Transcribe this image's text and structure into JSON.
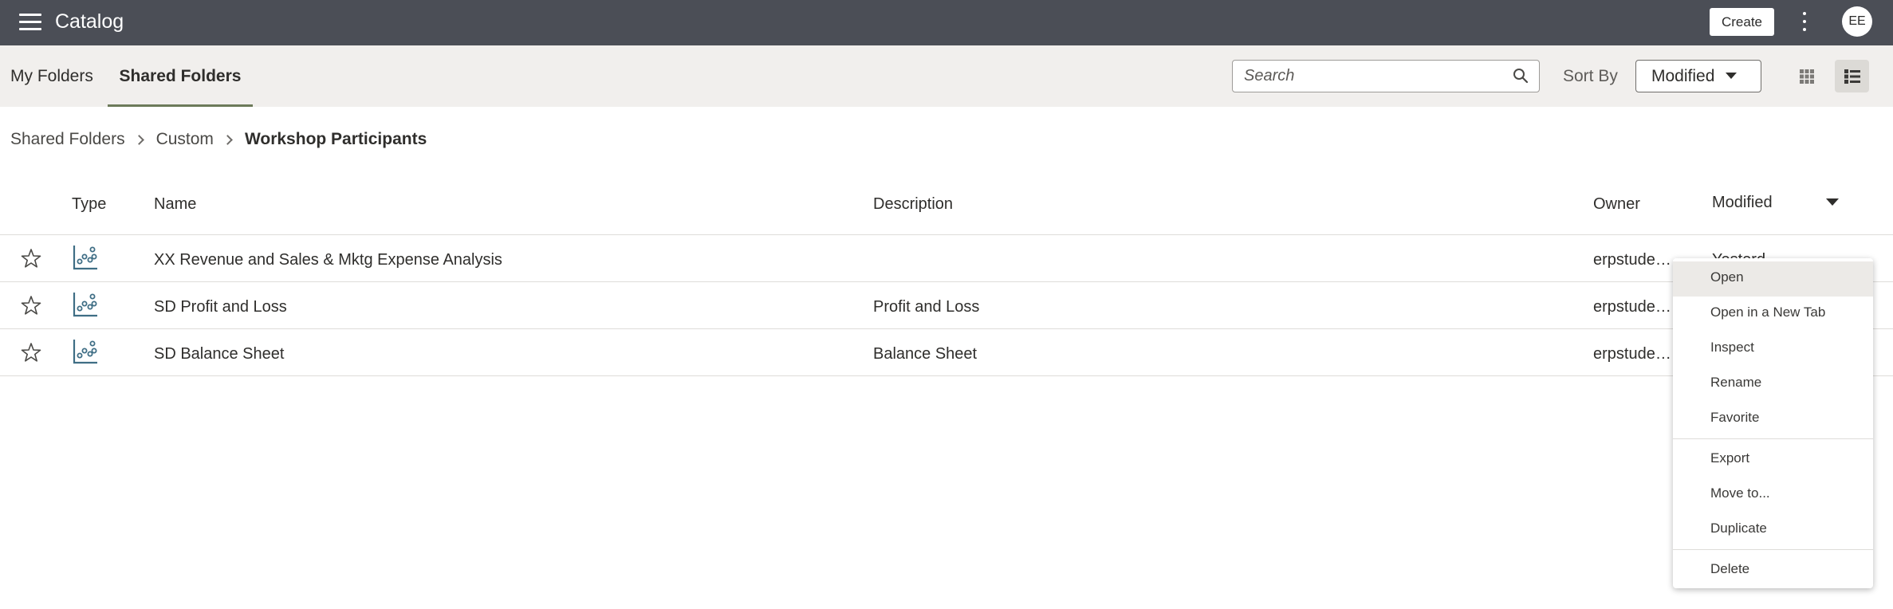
{
  "topbar": {
    "app_title": "Catalog",
    "create_label": "Create",
    "avatar_initials": "EE",
    "bg_color": "#4b4e56"
  },
  "tabs": {
    "my_folders": "My Folders",
    "shared_folders": "Shared Folders",
    "active": "Shared Folders"
  },
  "toolbar": {
    "search_placeholder": "Search",
    "sort_by_label": "Sort By",
    "sort_value": "Modified",
    "view_mode": "list"
  },
  "breadcrumb": {
    "items": [
      "Shared Folders",
      "Custom"
    ],
    "current": "Workshop Participants"
  },
  "table": {
    "headers": {
      "type": "Type",
      "name": "Name",
      "description": "Description",
      "owner": "Owner",
      "modified": "Modified"
    },
    "rows": [
      {
        "icon": "scatter-chart-icon",
        "name": "XX Revenue and Sales & Mktg Expense Analysis",
        "description": "",
        "owner": "erpstude…",
        "modified": "Yesterd"
      },
      {
        "icon": "scatter-chart-icon",
        "name": "SD Profit and Loss",
        "description": "Profit and Loss",
        "owner": "erpstude…",
        "modified": ""
      },
      {
        "icon": "scatter-chart-icon",
        "name": "SD Balance Sheet",
        "description": "Balance Sheet",
        "owner": "erpstude…",
        "modified": ""
      }
    ]
  },
  "context_menu": {
    "highlighted": "Open",
    "items": [
      "Open",
      "Open in a New Tab",
      "Inspect",
      "Rename",
      "Favorite",
      "Export",
      "Move to...",
      "Duplicate",
      "Delete"
    ]
  }
}
